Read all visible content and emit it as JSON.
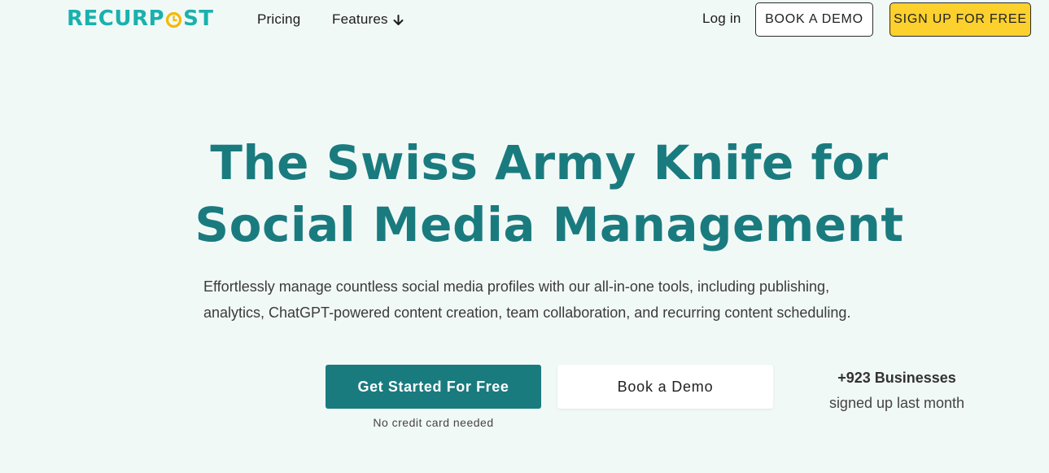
{
  "nav": {
    "logo_left": "RECURP",
    "logo_right": "ST",
    "pricing": "Pricing",
    "features": "Features",
    "login": "Log in",
    "book_demo": "BOOK A DEMO",
    "signup": "SIGN UP FOR FREE"
  },
  "hero": {
    "title_line1": "The Swiss Army Knife for",
    "title_line2": "Social Media Management",
    "subtitle_line1": "Effortlessly manage countless social media profiles with our all-in-one tools, including publishing,",
    "subtitle_line2": "analytics, ChatGPT-powered content creation, team collaboration, and recurring content scheduling.",
    "cta_primary": "Get Started For Free",
    "cta_note": "No credit card needed",
    "cta_secondary": "Book a Demo",
    "stat_count": "+923 Businesses",
    "stat_text": "signed up last month"
  },
  "colors": {
    "background": "#f1f9f7",
    "brand_teal": "#1a7b7f",
    "logo_teal": "#1ab1ad",
    "logo_accent": "#f5b800",
    "signup_yellow": "#fcd02d"
  }
}
